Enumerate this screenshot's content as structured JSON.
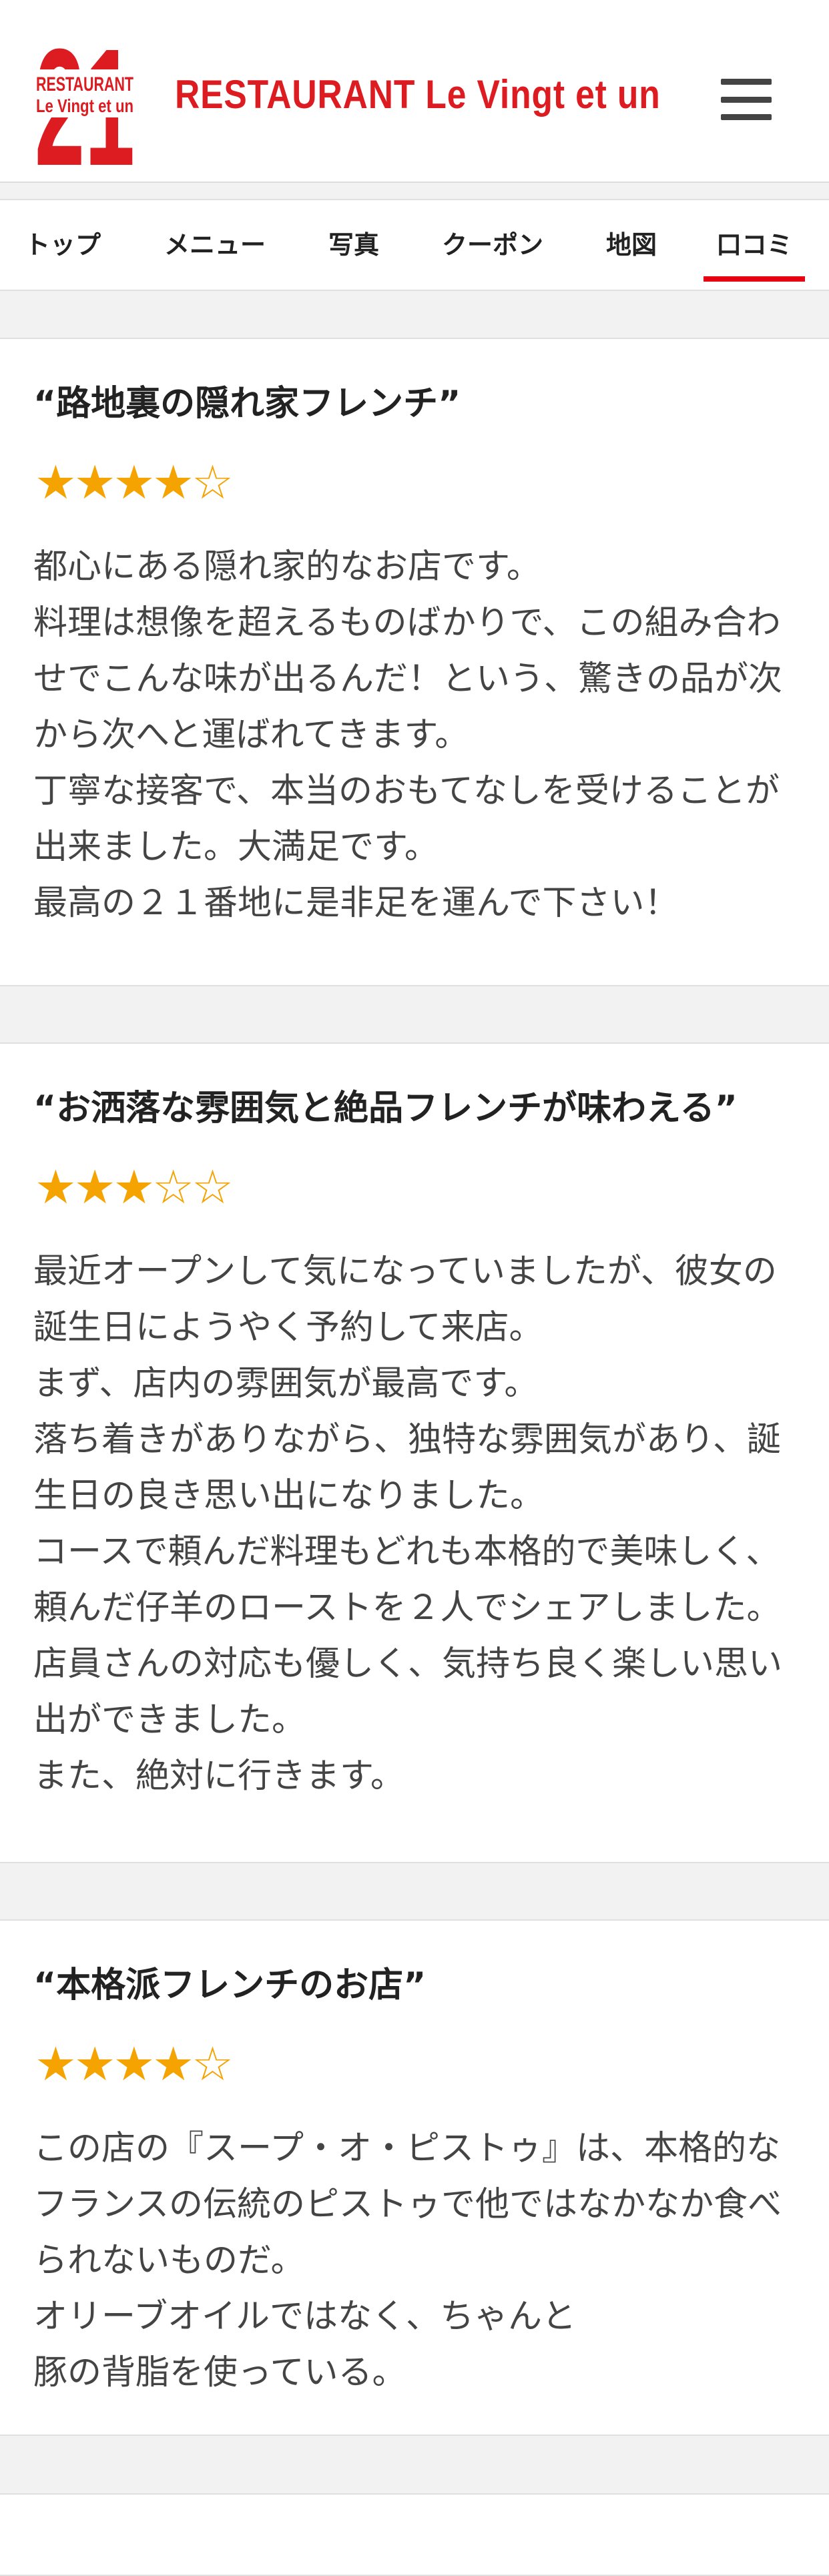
{
  "header": {
    "logo_number": "21",
    "logo_line1": "RESTAURANT",
    "logo_line2": "Le Vingt et un",
    "brand_title": "RESTAURANT  Le Vingt et un",
    "brand_color": "#dd1c22"
  },
  "nav": {
    "tabs": [
      {
        "label": "トップ",
        "active": false
      },
      {
        "label": "メニュー",
        "active": false
      },
      {
        "label": "写真",
        "active": false
      },
      {
        "label": "クーポン",
        "active": false
      },
      {
        "label": "地図",
        "active": false
      },
      {
        "label": "口コミ",
        "active": true
      }
    ],
    "active_color": "#e50012"
  },
  "reviews": [
    {
      "title": "“路地裏の隠れ家フレンチ”",
      "rating": 4,
      "max_rating": 5,
      "body": "都心にある隠れ家的なお店です。\n料理は想像を超えるものばかりで、この組み合わせでこんな味が出るんだ！という、驚きの品が次から次へと運ばれてきます。\n丁寧な接客で、本当のおもてなしを受けることが出来ました。大満足です。\n最高の２１番地に是非足を運んで下さい！"
    },
    {
      "title": "“お洒落な雰囲気と絶品フレンチが味わえる”",
      "rating": 3,
      "max_rating": 5,
      "body": "最近オープンして気になっていましたが、彼女の誕生日にようやく予約して来店。\nまず、店内の雰囲気が最高です。\n落ち着きがありながら、独特な雰囲気があり、誕生日の良き思い出になりました。\nコースで頼んだ料理もどれも本格的で美味しく、頼んだ仔羊のローストを２人でシェアしました。店員さんの対応も優しく、気持ち良く楽しい思い出ができました。\nまた、絶対に行きます。"
    },
    {
      "title": "“本格派フレンチのお店”",
      "rating": 4,
      "max_rating": 5,
      "body": "この店の『スープ・オ・ピストゥ』は、本格的なフランスの伝統のピストゥで他ではなかなか食べられないものだ。\nオリーブオイルではなく、ちゃんと\n豚の背脂を使っている。"
    }
  ],
  "star_color": "#f4a300"
}
